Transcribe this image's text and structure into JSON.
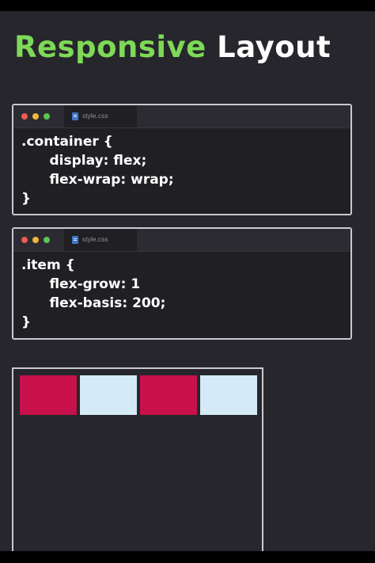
{
  "title": {
    "word1": "Responsive",
    "word2": "Layout"
  },
  "editors": [
    {
      "tab_label": "style.css",
      "lines": [
        ".container {",
        "      display: flex;",
        "      flex-wrap: wrap;",
        "}"
      ]
    },
    {
      "tab_label": "style.css",
      "lines": [
        ".item {",
        "      flex-grow: 1",
        "      flex-basis: 200;",
        "}"
      ]
    }
  ],
  "demo_items": [
    {
      "color": "#c8104a"
    },
    {
      "color": "#d3eaf7"
    },
    {
      "color": "#c8104a"
    },
    {
      "color": "#d3eaf7"
    }
  ],
  "colors": {
    "background": "#26262c",
    "title_accent": "#7ed957",
    "item_primary": "#c8104a",
    "item_secondary": "#d3eaf7"
  }
}
